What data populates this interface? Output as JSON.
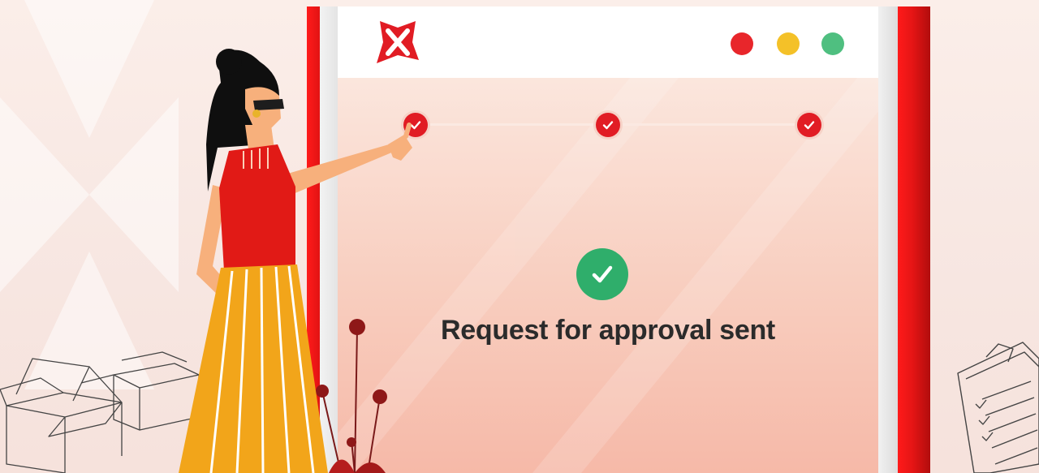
{
  "window": {
    "logo_icon": "dbs-x-logo-icon",
    "traffic_lights": [
      "red",
      "yellow",
      "green"
    ]
  },
  "progress": {
    "steps": [
      {
        "state": "complete",
        "icon": "check-icon"
      },
      {
        "state": "complete",
        "icon": "check-icon"
      },
      {
        "state": "complete",
        "icon": "check-icon"
      }
    ]
  },
  "status": {
    "icon": "check-circle-icon",
    "text": "Request for approval sent"
  },
  "colors": {
    "brand_red": "#e11c24",
    "success_green": "#2fae6b",
    "text_dark": "#2b2b2b",
    "light_red": "#e8262b",
    "light_yellow": "#f4c128",
    "light_green": "#4fbf80"
  }
}
